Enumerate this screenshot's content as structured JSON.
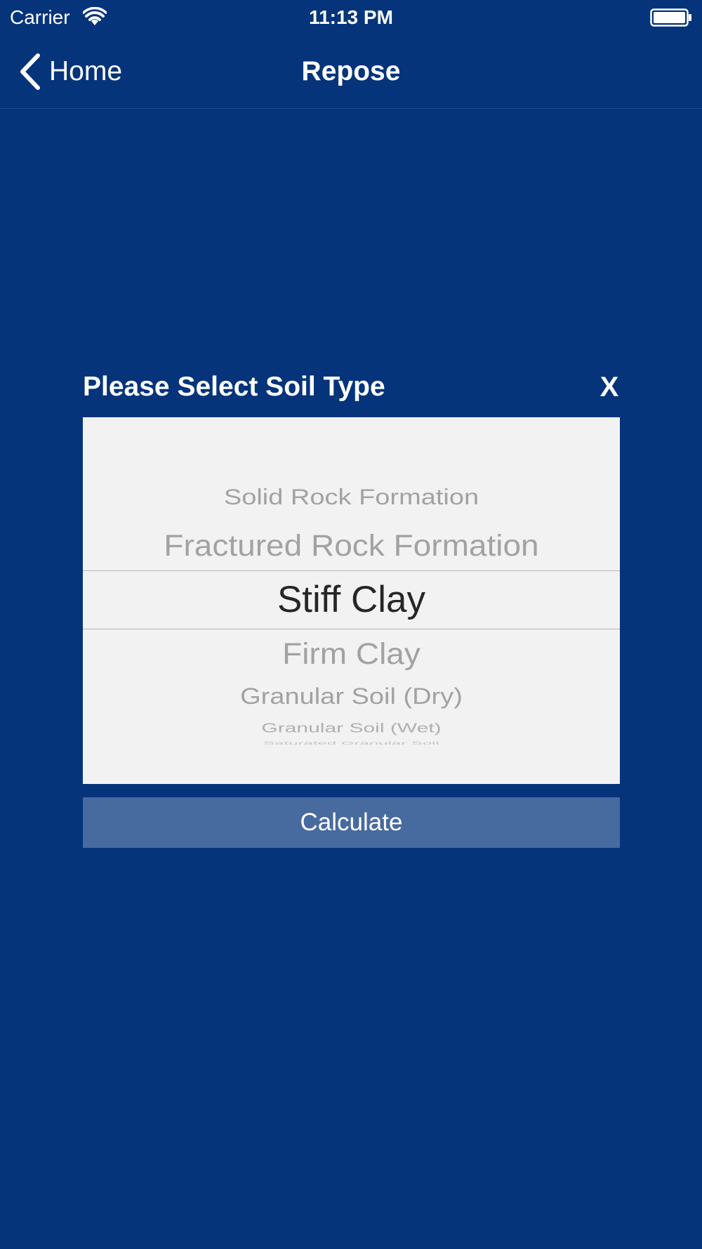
{
  "status_bar": {
    "carrier": "Carrier",
    "time": "11:13 PM",
    "wifi_icon": "wifi-icon",
    "battery_icon": "battery-icon"
  },
  "nav": {
    "back_label": "Home",
    "back_icon": "chevron-left-icon",
    "title": "Repose"
  },
  "dialog": {
    "title": "Please Select Soil Type",
    "close_label": "X",
    "picker": {
      "selected": "Stiff Clay",
      "items": [
        "Solid Rock Formation",
        "Fractured Rock Formation",
        "Stiff Clay",
        "Firm Clay",
        "Granular Soil (Dry)",
        "Granular Soil (Wet)",
        "Saturated Granular Soil"
      ]
    },
    "calculate_label": "Calculate"
  },
  "colors": {
    "background": "#05347b",
    "picker_background": "#f2f2f2",
    "button_background": "#476a9f",
    "selected_text": "#262626",
    "unselected_text": "#a2a2a2"
  }
}
